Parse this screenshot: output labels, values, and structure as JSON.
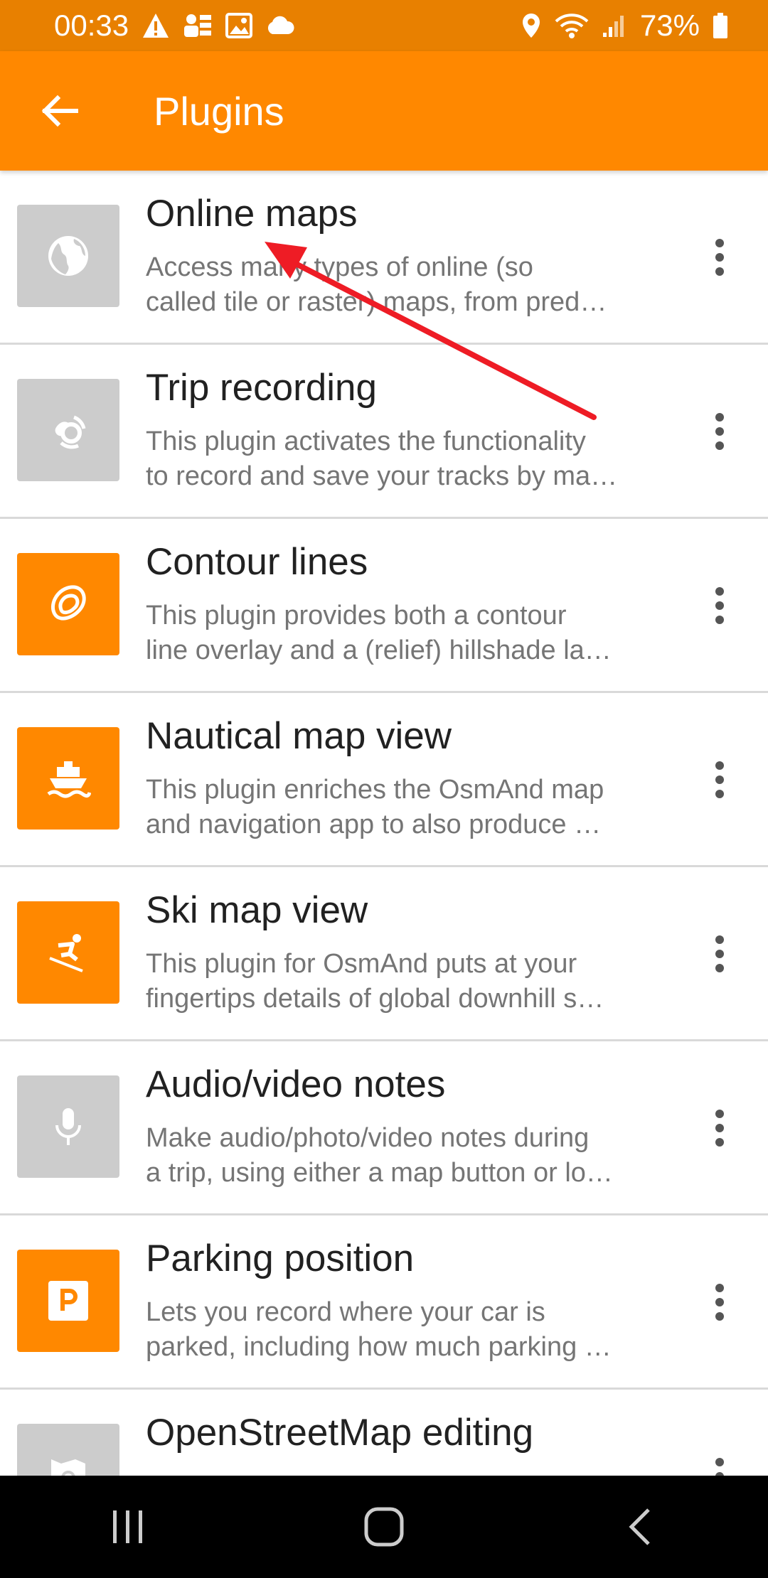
{
  "status_bar": {
    "time": "00:33",
    "battery": "73%",
    "icons_left": [
      "warning-icon",
      "contacts-icon",
      "gallery-icon",
      "cloud-icon"
    ],
    "icons_right": [
      "location-icon",
      "wifi-icon",
      "signal-icon",
      "battery-icon"
    ]
  },
  "app_bar": {
    "title": "Plugins",
    "back_icon": "arrow-left-icon",
    "color": "#ff8800"
  },
  "plugins": [
    {
      "title": "Online maps",
      "desc1": "Access many types of online (so",
      "desc2": "called tile or raster) maps, from pred…",
      "icon": "globe-icon",
      "enabled": false
    },
    {
      "title": "Trip recording",
      "desc1": "This plugin activates the functionality",
      "desc2": "to record and save your tracks by ma…",
      "icon": "trip-recording-icon",
      "enabled": false
    },
    {
      "title": "Contour lines",
      "desc1": "This plugin provides both a contour",
      "desc2": "line overlay and a (relief) hillshade la…",
      "icon": "contour-icon",
      "enabled": true
    },
    {
      "title": "Nautical map view",
      "desc1": "This plugin enriches the OsmAnd map",
      "desc2": "and navigation app to also produce …",
      "icon": "ship-icon",
      "enabled": true
    },
    {
      "title": "Ski map view",
      "desc1": "This plugin for OsmAnd puts at your",
      "desc2": "fingertips details of global downhill s…",
      "icon": "skier-icon",
      "enabled": true
    },
    {
      "title": "Audio/video notes",
      "desc1": "Make audio/photo/video notes during",
      "desc2": "a trip, using either a map button or lo…",
      "icon": "microphone-icon",
      "enabled": false
    },
    {
      "title": "Parking position",
      "desc1": "Lets you record where your car is",
      "desc2": "parked, including how much parking …",
      "icon": "parking-icon",
      "enabled": true
    },
    {
      "title": "OpenStreetMap editing",
      "desc1": "",
      "desc2": "",
      "icon": "osm-edit-icon",
      "enabled": false
    }
  ],
  "nav_bar": {
    "recents_icon": "recents-icon",
    "home_icon": "home-icon",
    "back_icon": "nav-back-icon"
  },
  "annotation": {
    "icon": "red-arrow-icon",
    "color": "#ee1c25"
  }
}
